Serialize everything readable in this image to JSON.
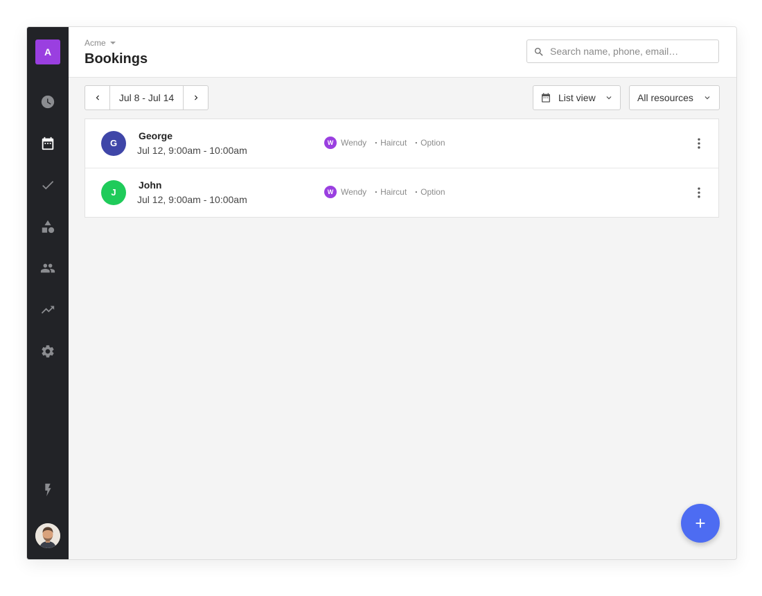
{
  "org": {
    "badge_letter": "A",
    "name": "Acme"
  },
  "header": {
    "title": "Bookings"
  },
  "search": {
    "placeholder": "Search name, phone, email…",
    "value": ""
  },
  "sidebar": {
    "items": [
      {
        "icon": "clock-icon",
        "label": "History"
      },
      {
        "icon": "calendar-icon",
        "label": "Bookings",
        "active": true
      },
      {
        "icon": "check-icon",
        "label": "Tasks"
      },
      {
        "icon": "shapes-icon",
        "label": "Services"
      },
      {
        "icon": "people-icon",
        "label": "Customers"
      },
      {
        "icon": "trending-up-icon",
        "label": "Reports"
      },
      {
        "icon": "gear-icon",
        "label": "Settings"
      }
    ],
    "bottom_icon": "bolt-icon"
  },
  "toolbar": {
    "date_range": "Jul 8 - Jul 14",
    "view_selected": "List view",
    "resource_selected": "All resources"
  },
  "bookings": [
    {
      "initial": "G",
      "avatar_color": "#3f46a8",
      "name": "George",
      "time": "Jul 12, 9:00am - 10:00am",
      "staff_initial": "W",
      "staff": "Wendy",
      "service": "Haircut",
      "option": "Option"
    },
    {
      "initial": "J",
      "avatar_color": "#1fcb5a",
      "name": "John",
      "time": "Jul 12, 9:00am - 10:00am",
      "staff_initial": "W",
      "staff": "Wendy",
      "service": "Haircut",
      "option": "Option"
    }
  ],
  "colors": {
    "sidebar_bg": "#222327",
    "accent_purple": "#9a3fe0",
    "fab_blue": "#4d6cf2"
  }
}
